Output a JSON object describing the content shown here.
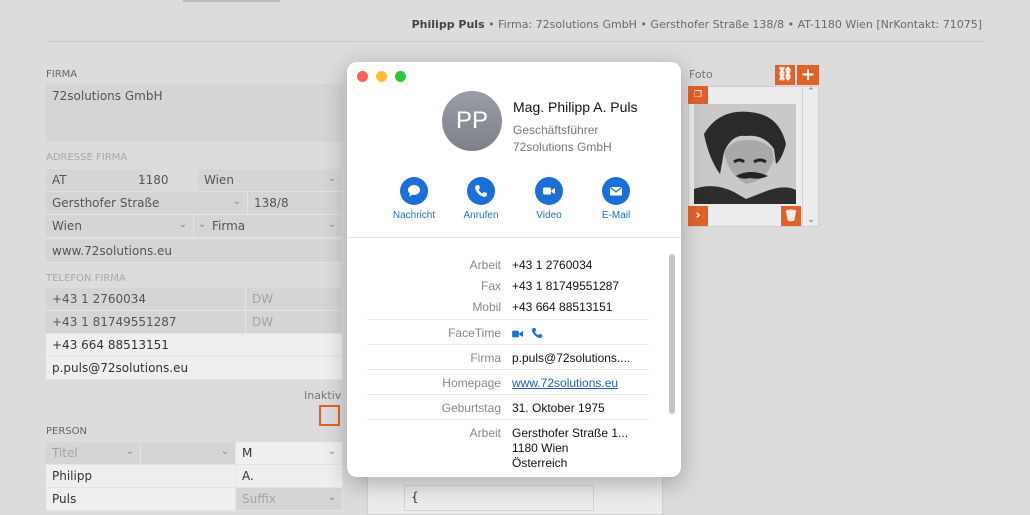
{
  "header": {
    "name": "Philipp Puls",
    "info": " • Firma: 72solutions GmbH • Gersthofer Straße 138/8 • AT-1180 Wien [NrKontakt: 71075]"
  },
  "firma": {
    "label": "FIRMA",
    "value": "72solutions GmbH"
  },
  "adresse": {
    "label": "ADRESSE FIRMA",
    "country": "AT",
    "zip": "1180",
    "city": "Wien",
    "street": "Gersthofer Straße",
    "number": "138/8",
    "region": "Wien",
    "type": "Firma",
    "website": "www.72solutions.eu"
  },
  "telefon": {
    "label": "TELEFON FIRMA",
    "phone1": "+43 1 2760034",
    "dw1": "DW",
    "phone2": "+43 1 81749551287",
    "dw2": "DW",
    "mobile": "+43 664 88513151",
    "email": "p.puls@72solutions.eu"
  },
  "inaktiv": {
    "label": "Inaktiv"
  },
  "person": {
    "label": "PERSON",
    "titel_placeholder": "Titel",
    "gender": "M",
    "first_name": "Philipp",
    "initial": "A.",
    "last_name": "Puls",
    "suffix_placeholder": "Suffix"
  },
  "foto": {
    "label": "Foto"
  },
  "lower": {
    "brace": "{"
  },
  "card": {
    "initials": "PP",
    "full_name": "Mag. Philipp A. Puls",
    "title": "Geschäftsführer",
    "company": "72solutions GmbH",
    "actions": {
      "message": "Nachricht",
      "call": "Anrufen",
      "video": "Video",
      "email": "E-Mail"
    },
    "details": {
      "arbeit_label": "Arbeit",
      "arbeit_value": "+43 1 2760034",
      "fax_label": "Fax",
      "fax_value": "+43 1 81749551287",
      "mobil_label": "Mobil",
      "mobil_value": "+43 664 88513151",
      "facetime_label": "FaceTime",
      "firma_label": "Firma",
      "firma_value": "p.puls@72solutions....",
      "homepage_label": "Homepage",
      "homepage_value": "www.72solutions.eu",
      "geburtstag_label": "Geburtstag",
      "geburtstag_value": "31. Oktober 1975",
      "address_label": "Arbeit",
      "address_line1": "Gersthofer Straße 1...",
      "address_line2": "1180 Wien",
      "address_line3": "Österreich"
    }
  },
  "colors": {
    "accent_orange": "#e0622a",
    "link_blue": "#1b6fd6",
    "close_red": "#fe5f57",
    "minimize_yellow": "#febc2e",
    "zoom_green": "#28c840"
  }
}
